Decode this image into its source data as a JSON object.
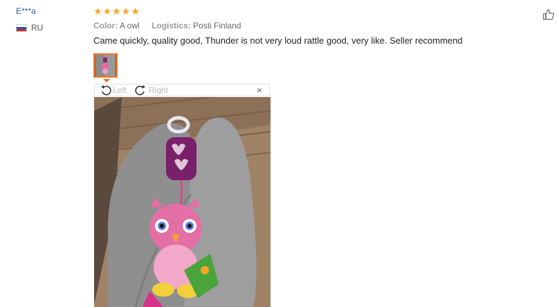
{
  "review": {
    "reviewer": "E***a",
    "country_code": "RU",
    "rating": 5,
    "stars": [
      "★",
      "★",
      "★",
      "★",
      "★"
    ],
    "color_label": "Color:",
    "color_value": "A owl",
    "logistics_label": "Logistics:",
    "logistics_value": "Posti Finland",
    "feedback": "Came quickly, quality good, Thunder is not very loud rattle good, very like. Seller recommend"
  },
  "viewer": {
    "rotate_left_label": "Left",
    "rotate_right_label": "Right",
    "close_glyph": "×"
  },
  "colors": {
    "accent": "#f57224",
    "star": "#f5a623",
    "name": "#2e5ea8"
  },
  "icons": [
    "thumbs-up-icon",
    "rotate-left-icon",
    "rotate-right-icon",
    "close-icon",
    "flag-icon"
  ]
}
